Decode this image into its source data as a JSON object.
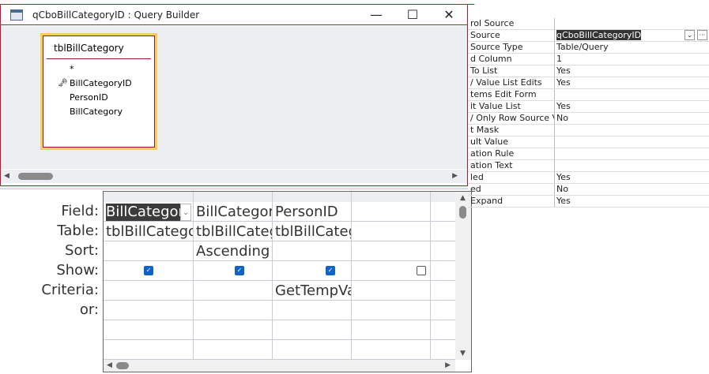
{
  "window": {
    "title": "qCboBillCategoryID : Query Builder",
    "minimize": "—",
    "maximize": "☐",
    "close": "✕"
  },
  "table_box": {
    "name": "tblBillCategory",
    "fields": [
      "*",
      "BillCategoryID",
      "PersonID",
      "BillCategory"
    ],
    "key_field": "BillCategoryID"
  },
  "grid": {
    "row_labels": [
      "Field:",
      "Table:",
      "Sort:",
      "Show:",
      "Criteria:",
      "or:"
    ],
    "columns": [
      {
        "field": "BillCategoryID",
        "table": "tblBillCategory",
        "sort": "",
        "show": true,
        "criteria": ""
      },
      {
        "field": "BillCategory",
        "table": "tblBillCategory",
        "sort": "Ascending",
        "show": true,
        "criteria": ""
      },
      {
        "field": "PersonID",
        "table": "tblBillCategory",
        "sort": "",
        "show": true,
        "criteria": "GetTempVar"
      },
      {
        "field": "",
        "table": "",
        "sort": "",
        "show": false,
        "criteria": ""
      }
    ]
  },
  "properties": [
    {
      "name": "rol Source",
      "value": ""
    },
    {
      "name": "Source",
      "value": "qCboBillCategoryID"
    },
    {
      "name": "Source Type",
      "value": "Table/Query"
    },
    {
      "name": "d Column",
      "value": "1"
    },
    {
      "name": "To List",
      "value": "Yes"
    },
    {
      "name": "/ Value List Edits",
      "value": "Yes"
    },
    {
      "name": "tems Edit Form",
      "value": ""
    },
    {
      "name": "it Value List",
      "value": "Yes"
    },
    {
      "name": "/ Only Row Source V",
      "value": "No"
    },
    {
      "name": "t Mask",
      "value": ""
    },
    {
      "name": "ult Value",
      "value": ""
    },
    {
      "name": "ation Rule",
      "value": ""
    },
    {
      "name": "ation Text",
      "value": ""
    },
    {
      "name": "led",
      "value": "Yes"
    },
    {
      "name": "ed",
      "value": "No"
    },
    {
      "name": "Expand",
      "value": "Yes"
    }
  ]
}
